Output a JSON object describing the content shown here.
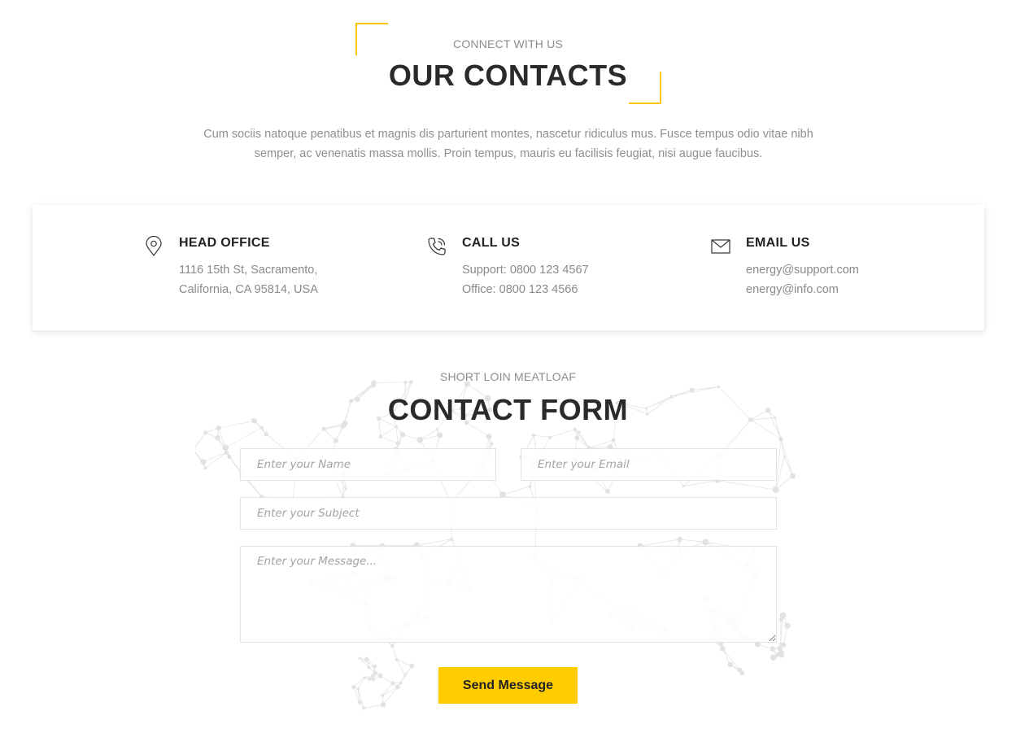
{
  "contacts_section": {
    "eyebrow": "CONNECT WITH US",
    "title": "OUR CONTACTS",
    "intro": "Cum sociis natoque penatibus et magnis dis parturient montes, nascetur ridiculus mus. Fusce tempus odio vitae nibh semper, ac venenatis massa mollis. Proin tempus, mauris eu facilisis feugiat, nisi augue faucibus."
  },
  "info_cards": [
    {
      "icon": "map-pin-icon",
      "title": "HEAD OFFICE",
      "line1": "1116 15th St, Sacramento,",
      "line2": "California, CA 95814, USA"
    },
    {
      "icon": "phone-icon",
      "title": "CALL US",
      "line1": "Support: 0800 123 4567",
      "line2": "Office: 0800 123 4566"
    },
    {
      "icon": "envelope-icon",
      "title": "EMAIL US",
      "line1": "energy@support.com",
      "line2": "energy@info.com"
    }
  ],
  "form_section": {
    "eyebrow": "SHORT LOIN MEATLOAF",
    "title": "CONTACT FORM",
    "name_placeholder": "Enter your Name",
    "email_placeholder": "Enter your Email",
    "subject_placeholder": "Enter your Subject",
    "message_placeholder": "Enter your Message...",
    "submit_label": "Send Message"
  },
  "colors": {
    "accent": "#ffcc00",
    "heading": "#2a2a2a",
    "muted_text": "#8f8f8f"
  }
}
